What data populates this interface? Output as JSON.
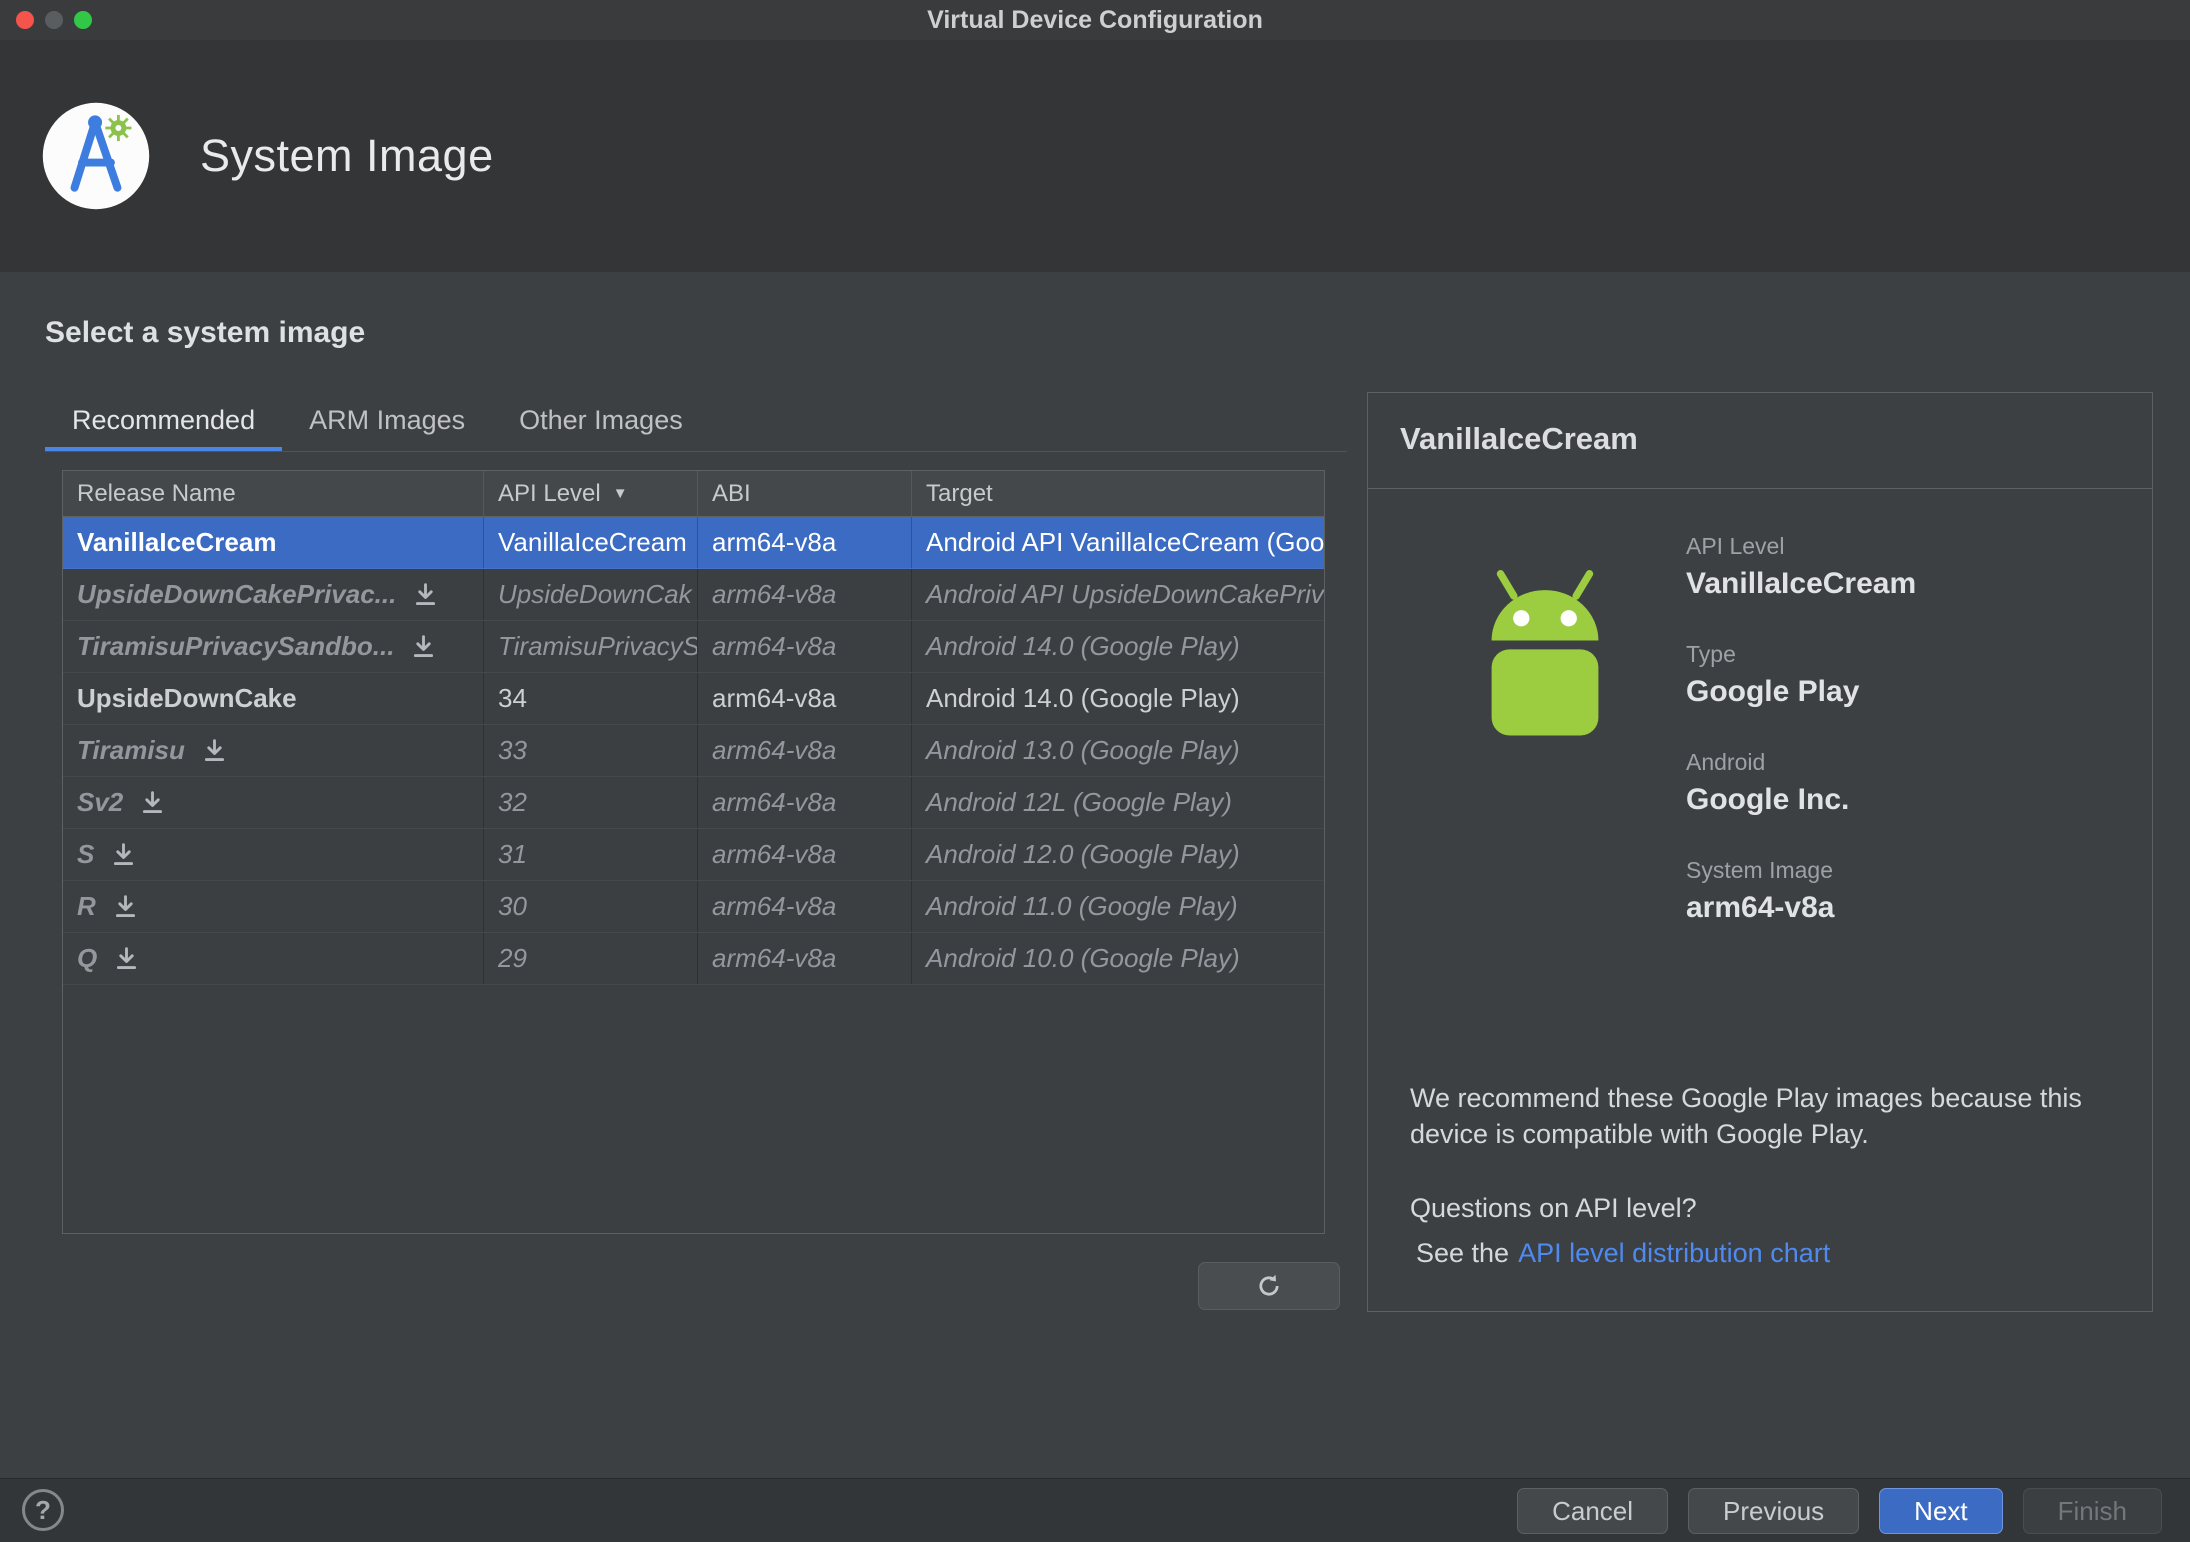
{
  "window": {
    "title": "Virtual Device Configuration",
    "traffic_lights": {
      "close": "#F5544D",
      "minimize": "#5A5D5F",
      "zoom": "#33C748"
    }
  },
  "header": {
    "title": "System Image"
  },
  "section": {
    "title": "Select a system image"
  },
  "tabs": {
    "items": [
      {
        "label": "Recommended",
        "active": true
      },
      {
        "label": "ARM Images",
        "active": false
      },
      {
        "label": "Other Images",
        "active": false
      }
    ]
  },
  "table": {
    "columns": [
      "Release Name",
      "API Level",
      "ABI",
      "Target"
    ],
    "sorted_column": "API Level",
    "sort_glyph": "▼",
    "rows": [
      {
        "name": "VanillaIceCream",
        "api": "VanillaIceCream",
        "abi": "arm64-v8a",
        "target": "Android API VanillaIceCream (Goo",
        "selected": true,
        "dim": false,
        "download": false
      },
      {
        "name": "UpsideDownCakePrivac...",
        "api": "UpsideDownCak",
        "abi": "arm64-v8a",
        "target": "Android API UpsideDownCakePriv",
        "selected": false,
        "dim": true,
        "download": true
      },
      {
        "name": "TiramisuPrivacySandbo...",
        "api": "TiramisuPrivacyS",
        "abi": "arm64-v8a",
        "target": "Android 14.0 (Google Play)",
        "selected": false,
        "dim": true,
        "download": true
      },
      {
        "name": "UpsideDownCake",
        "api": "34",
        "abi": "arm64-v8a",
        "target": "Android 14.0 (Google Play)",
        "selected": false,
        "dim": false,
        "download": false
      },
      {
        "name": "Tiramisu",
        "api": "33",
        "abi": "arm64-v8a",
        "target": "Android 13.0 (Google Play)",
        "selected": false,
        "dim": true,
        "download": true
      },
      {
        "name": "Sv2",
        "api": "32",
        "abi": "arm64-v8a",
        "target": "Android 12L (Google Play)",
        "selected": false,
        "dim": true,
        "download": true
      },
      {
        "name": "S",
        "api": "31",
        "abi": "arm64-v8a",
        "target": "Android 12.0 (Google Play)",
        "selected": false,
        "dim": true,
        "download": true
      },
      {
        "name": "R",
        "api": "30",
        "abi": "arm64-v8a",
        "target": "Android 11.0 (Google Play)",
        "selected": false,
        "dim": true,
        "download": true
      },
      {
        "name": "Q",
        "api": "29",
        "abi": "arm64-v8a",
        "target": "Android 10.0 (Google Play)",
        "selected": false,
        "dim": true,
        "download": true
      }
    ]
  },
  "details": {
    "title": "VanillaIceCream",
    "fields": [
      {
        "label": "API Level",
        "value": "VanillaIceCream"
      },
      {
        "label": "Type",
        "value": "Google Play"
      },
      {
        "label": "Android",
        "value": "Google Inc."
      },
      {
        "label": "System Image",
        "value": "arm64-v8a"
      }
    ],
    "recommendation": "We recommend these Google Play images because this device is compatible with Google Play.",
    "question": "Questions on API level?",
    "link_prefix": "See the",
    "link_text": "API level distribution chart"
  },
  "footer": {
    "help": "?",
    "buttons": [
      {
        "label": "Cancel",
        "type": "default"
      },
      {
        "label": "Previous",
        "type": "default"
      },
      {
        "label": "Next",
        "type": "primary"
      },
      {
        "label": "Finish",
        "type": "disabled"
      }
    ]
  },
  "colors": {
    "selection": "#3B6BC2",
    "accent_button": "#3B6BC2",
    "tab_underline": "#4A85E8",
    "link": "#4E8AF0",
    "android_green": "#9CCC3F"
  },
  "icons": {
    "download": "download-icon",
    "refresh": "refresh-icon",
    "sort": "sort-descending-icon",
    "logo": "android-studio-logo-icon",
    "robot": "android-robot-icon",
    "help": "help-icon"
  }
}
